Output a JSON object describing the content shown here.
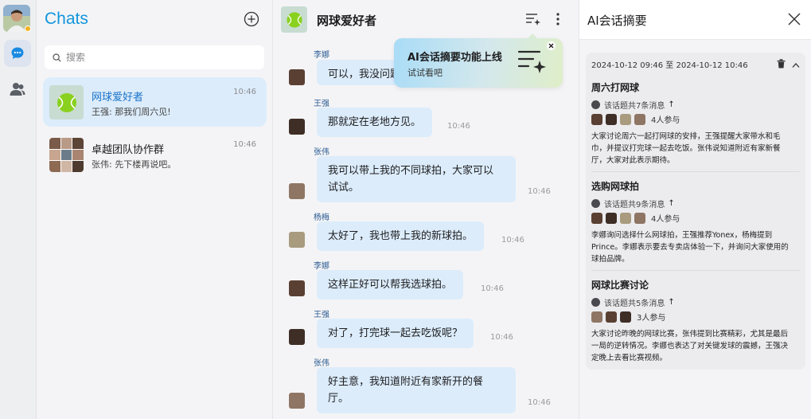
{
  "list": {
    "title": "Chats",
    "search_placeholder": "搜索",
    "chats": [
      {
        "name": "网球爱好者",
        "preview": "王强: 那我们周六见!",
        "time": "10:46"
      },
      {
        "name": "卓越团队协作群",
        "preview": "张伟: 先下楼再说吧。",
        "time": "10:46"
      }
    ]
  },
  "conversation": {
    "title": "网球爱好者",
    "messages": [
      {
        "sender": "李娜",
        "text": "可以，我没问题",
        "time": ""
      },
      {
        "sender": "王强",
        "text": "那就定在老地方见。",
        "time": "10:46"
      },
      {
        "sender": "张伟",
        "text_line1": "我可以带上我的不同球拍，大家可以",
        "text_line2": "试试。",
        "time": "10:46"
      },
      {
        "sender": "杨梅",
        "text": "太好了，我也带上我的新球拍。",
        "time": "10:46"
      },
      {
        "sender": "李娜",
        "text": "这样正好可以帮我选球拍。",
        "time": "10:46"
      },
      {
        "sender": "王强",
        "text": "对了，打完球一起去吃饭呢？",
        "time": "10:46"
      },
      {
        "sender": "张伟",
        "text_line1": "好主意，我知道附近有家新开的餐",
        "text_line2": "厅。",
        "time": "10:46"
      }
    ]
  },
  "promo": {
    "title": "AI会话摘要功能上线",
    "subtitle": "试试看吧"
  },
  "ai_panel": {
    "title": "AI会话摘要",
    "range": "2024-10-12 09:46 至 2024-10-12 10:46",
    "topics": [
      {
        "title": "周六打网球",
        "meta": "该话题共7条消息",
        "participants": "4人参与",
        "desc_lines": [
          "大家讨论周六一起打网球的安排，王强提醒大家带水和毛",
          "巾，并提议打完球一起去吃饭。张伟说知道附近有家新餐",
          "厅，大家对此表示期待。"
        ]
      },
      {
        "title": "选购网球拍",
        "meta": "该话题共9条消息",
        "participants": "4人参与",
        "desc_lines": [
          "李娜询问选择什么网球拍，王强推荐Yonex，杨梅提到",
          "Prince。李娜表示要去专卖店体验一下，并询问大家使用的",
          "球拍品牌。"
        ]
      },
      {
        "title": "网球比赛讨论",
        "meta": "该话题共5条消息",
        "participants": "3人参与",
        "desc_lines": [
          "大家讨论昨晚的网球比赛，张伟提到比赛精彩，尤其是最后",
          "一局的逆转情况。李娜也表达了对关键发球的震撼，王强决",
          "定晚上去看比赛视频。"
        ]
      }
    ]
  },
  "colors": {
    "accent": "#1296db",
    "bubble": "#dcecfb",
    "selected": "#dcecfa"
  }
}
